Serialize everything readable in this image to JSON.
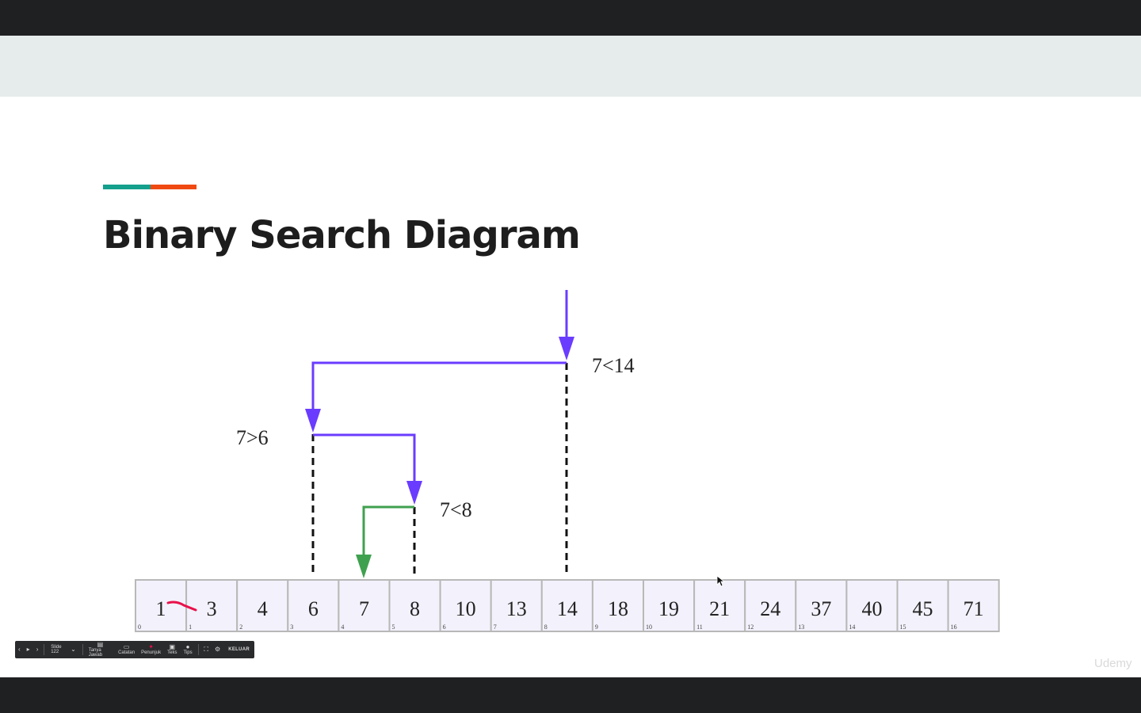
{
  "slide": {
    "title": "Binary Search Diagram"
  },
  "diagram": {
    "array": [
      {
        "value": "1",
        "index": "0"
      },
      {
        "value": "3",
        "index": "1"
      },
      {
        "value": "4",
        "index": "2"
      },
      {
        "value": "6",
        "index": "3"
      },
      {
        "value": "7",
        "index": "4"
      },
      {
        "value": "8",
        "index": "5"
      },
      {
        "value": "10",
        "index": "6"
      },
      {
        "value": "13",
        "index": "7"
      },
      {
        "value": "14",
        "index": "8"
      },
      {
        "value": "18",
        "index": "9"
      },
      {
        "value": "19",
        "index": "10"
      },
      {
        "value": "21",
        "index": "11"
      },
      {
        "value": "24",
        "index": "12"
      },
      {
        "value": "37",
        "index": "13"
      },
      {
        "value": "40",
        "index": "14"
      },
      {
        "value": "45",
        "index": "15"
      },
      {
        "value": "71",
        "index": "16"
      }
    ],
    "comparisons": {
      "first": "7<14",
      "second": "7>6",
      "third": "7<8"
    },
    "colors": {
      "search_arrow": "#6a3cff",
      "found_arrow": "#3fa14f",
      "ink_mark": "#e8114a",
      "cell_fill": "#f3f1fb",
      "cell_border": "#b8b8b8"
    }
  },
  "presenter_toolbar": {
    "slide_label": "Slide 122",
    "buttons": [
      "Tanya Jawab",
      "Catatan",
      "Penunjuk",
      "Teks",
      "Tips"
    ],
    "exit_label": "KELUAR"
  },
  "watermark": "Udemy"
}
